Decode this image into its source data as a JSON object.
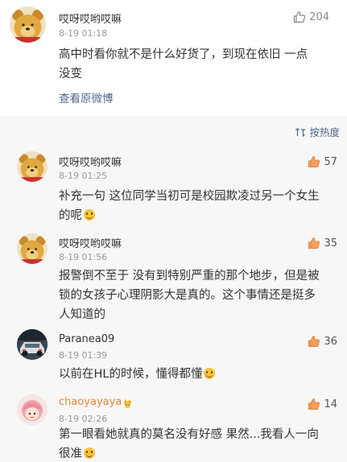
{
  "main_comment": {
    "username": "哎呀哎哟哎嘛",
    "timestamp": "8-19 01:18",
    "likes": "204",
    "text_line1": "高中时看你就不是什么好货了，到现在依旧 一点",
    "text_line2": "没变",
    "view_original": "查看原微博"
  },
  "replies_header": {
    "sort_label": "按热度",
    "sort_icon": "sort-icon"
  },
  "replies": [
    {
      "username": "哎呀哎哟哎嘛",
      "timestamp": "8-19 01:25",
      "likes": "57",
      "lines": [
        "补充一句 这位同学当初可是校园欺凌过另一个女生",
        "的呢"
      ],
      "emoji": "smile-emoji"
    },
    {
      "username": "哎呀哎哟哎嘛",
      "timestamp": "8-19 01:56",
      "likes": "35",
      "lines": [
        "报警倒不至于 没有到特别严重的那个地步，但是被",
        "锁的女孩子心理阴影大是真的。这个事情还是挺多",
        "人知道的"
      ]
    },
    {
      "username": "Paranea09",
      "timestamp": "8-19 01:39",
      "likes": "36",
      "lines": [
        "以前在HL的时候，懂得都懂"
      ],
      "emoji": "laugh-emoji"
    },
    {
      "username": "chaoyayaya",
      "timestamp": "8-19 02:26",
      "likes": "14",
      "lines": [
        "第一眼看她就真的莫名没有好感 果然...我看人一向",
        "很准"
      ],
      "emoji": "smile-emoji",
      "badge": "fan-badge-icon"
    }
  ],
  "colors": {
    "link": "#53688a",
    "reply_bg": "#f7f7f7",
    "like_orange": "#e8863a",
    "username_vip": "#e8863a"
  }
}
